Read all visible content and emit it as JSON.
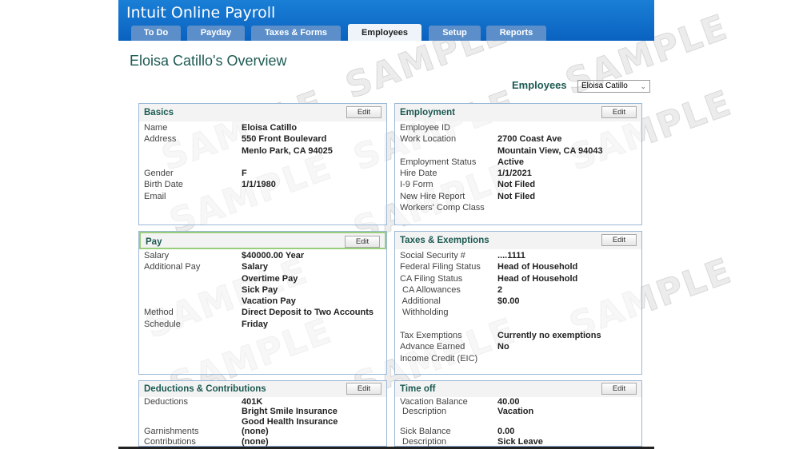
{
  "app": {
    "title": "Intuit Online Payroll"
  },
  "tabs": [
    {
      "label": "To Do"
    },
    {
      "label": "Payday"
    },
    {
      "label": "Taxes & Forms"
    },
    {
      "label": "Employees",
      "active": true
    },
    {
      "label": "Setup"
    },
    {
      "label": "Reports"
    }
  ],
  "page": {
    "title": "Eloisa Catillo's Overview",
    "employees_label": "Employees",
    "employee_selected": "Eloisa Catillo"
  },
  "watermark": "SAMPLE",
  "edit_label": "Edit",
  "panels": {
    "basics": {
      "title": "Basics",
      "rows": [
        [
          "Name",
          "Eloisa Catillo"
        ],
        [
          "Address",
          "550 Front Boulevard"
        ],
        [
          "",
          "Menlo Park,  CA 94025"
        ],
        [
          "",
          ""
        ],
        [
          "Gender",
          "F"
        ],
        [
          "Birth Date",
          "1/1/1980"
        ],
        [
          "Email",
          ""
        ]
      ]
    },
    "employment": {
      "title": "Employment",
      "rows": [
        [
          "Employee ID",
          ""
        ],
        [
          "Work Location",
          "2700 Coast Ave"
        ],
        [
          "",
          "Mountain View,  CA 94043"
        ],
        [
          "Employment Status",
          "Active"
        ],
        [
          "Hire Date",
          "1/1/2021"
        ],
        [
          "I-9 Form",
          "Not Filed"
        ],
        [
          "New Hire Report",
          "Not Filed"
        ],
        [
          "Workers' Comp Class",
          ""
        ]
      ]
    },
    "pay": {
      "title": "Pay",
      "rows": [
        [
          "Salary",
          "$40000.00 Year"
        ],
        [
          "Additional Pay",
          "Salary"
        ],
        [
          "",
          "Overtime Pay"
        ],
        [
          "",
          "Sick Pay"
        ],
        [
          "",
          "Vacation Pay"
        ],
        [
          "Method",
          "Direct Deposit to Two Accounts"
        ],
        [
          "Schedule",
          "Friday"
        ]
      ]
    },
    "taxes": {
      "title": "Taxes & Exemptions",
      "rows": [
        [
          "Social Security #",
          "....1111"
        ],
        [
          "Federal Filing Status",
          "Head of Household"
        ],
        [
          "CA Filing Status",
          "Head of Household"
        ],
        [
          " CA Allowances",
          "2"
        ],
        [
          " Additional",
          "$0.00"
        ],
        [
          " Withholding",
          ""
        ],
        [
          "",
          ""
        ],
        [
          "Tax Exemptions",
          "Currently no exemptions"
        ],
        [
          "Advance Earned",
          "No"
        ],
        [
          "Income Credit (EIC)",
          ""
        ]
      ]
    },
    "deductions": {
      "title": "Deductions & Contributions",
      "rows": [
        [
          "Deductions",
          "401K"
        ],
        [
          "",
          "Bright Smile Insurance"
        ],
        [
          "",
          "Good Health Insurance"
        ],
        [
          "Garnishments",
          "(none)"
        ],
        [
          "Contributions",
          "(none)"
        ]
      ]
    },
    "timeoff": {
      "title": "Time off",
      "rows": [
        [
          "Vacation Balance",
          "40.00"
        ],
        [
          " Description",
          "Vacation"
        ],
        [
          "",
          ""
        ],
        [
          "Sick Balance",
          "0.00"
        ],
        [
          " Description",
          "Sick Leave"
        ]
      ]
    }
  }
}
